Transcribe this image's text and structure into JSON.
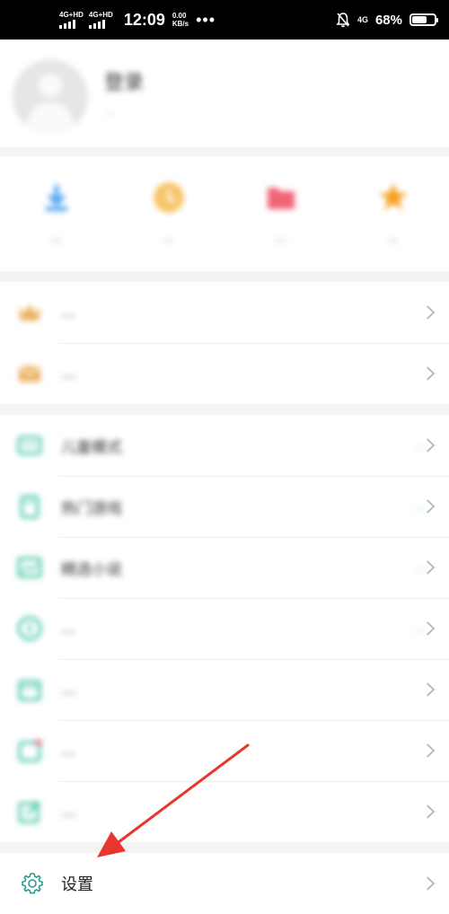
{
  "status_bar": {
    "network_1": "4G+HD",
    "network_2": "4G+HD",
    "time": "12:09",
    "speed_value": "0.00",
    "speed_unit": "KB/s",
    "more": "•••",
    "network_right": "4G",
    "battery_percent": "68%",
    "battery_level": 0.68
  },
  "profile": {
    "title": "登录",
    "subtitle": "..."
  },
  "quick_actions": [
    {
      "label": "...",
      "icon": "download-icon",
      "color": "#4aa3f0"
    },
    {
      "label": "...",
      "icon": "clock-icon",
      "color": "#f5c56b"
    },
    {
      "label": "...",
      "icon": "folder-icon",
      "color": "#f06478"
    },
    {
      "label": "...",
      "icon": "star-icon",
      "color": "#f5a020"
    }
  ],
  "group1": [
    {
      "label": "...",
      "icon": "crown-icon",
      "color": "#e8b15c"
    },
    {
      "label": "...",
      "icon": "mail-icon",
      "color": "#e8b15c"
    }
  ],
  "group2": [
    {
      "label": "儿童模式",
      "tag": "...",
      "icon": "kids-icon"
    },
    {
      "label": "热门游戏",
      "tag": "...",
      "icon": "game-icon"
    },
    {
      "label": "精选小说",
      "tag": "...",
      "icon": "book-icon"
    },
    {
      "label": "...",
      "tag": "...",
      "icon": "coin-icon"
    },
    {
      "label": "...",
      "tag": "",
      "icon": "calendar-icon"
    },
    {
      "label": "...",
      "tag": "",
      "icon": "ad-icon"
    },
    {
      "label": "...",
      "tag": "",
      "icon": "edit-icon"
    }
  ],
  "settings": {
    "label": "设置",
    "icon": "gear-icon"
  },
  "colors": {
    "accent": "#3fc3a6",
    "arrow": "#e8362f"
  }
}
